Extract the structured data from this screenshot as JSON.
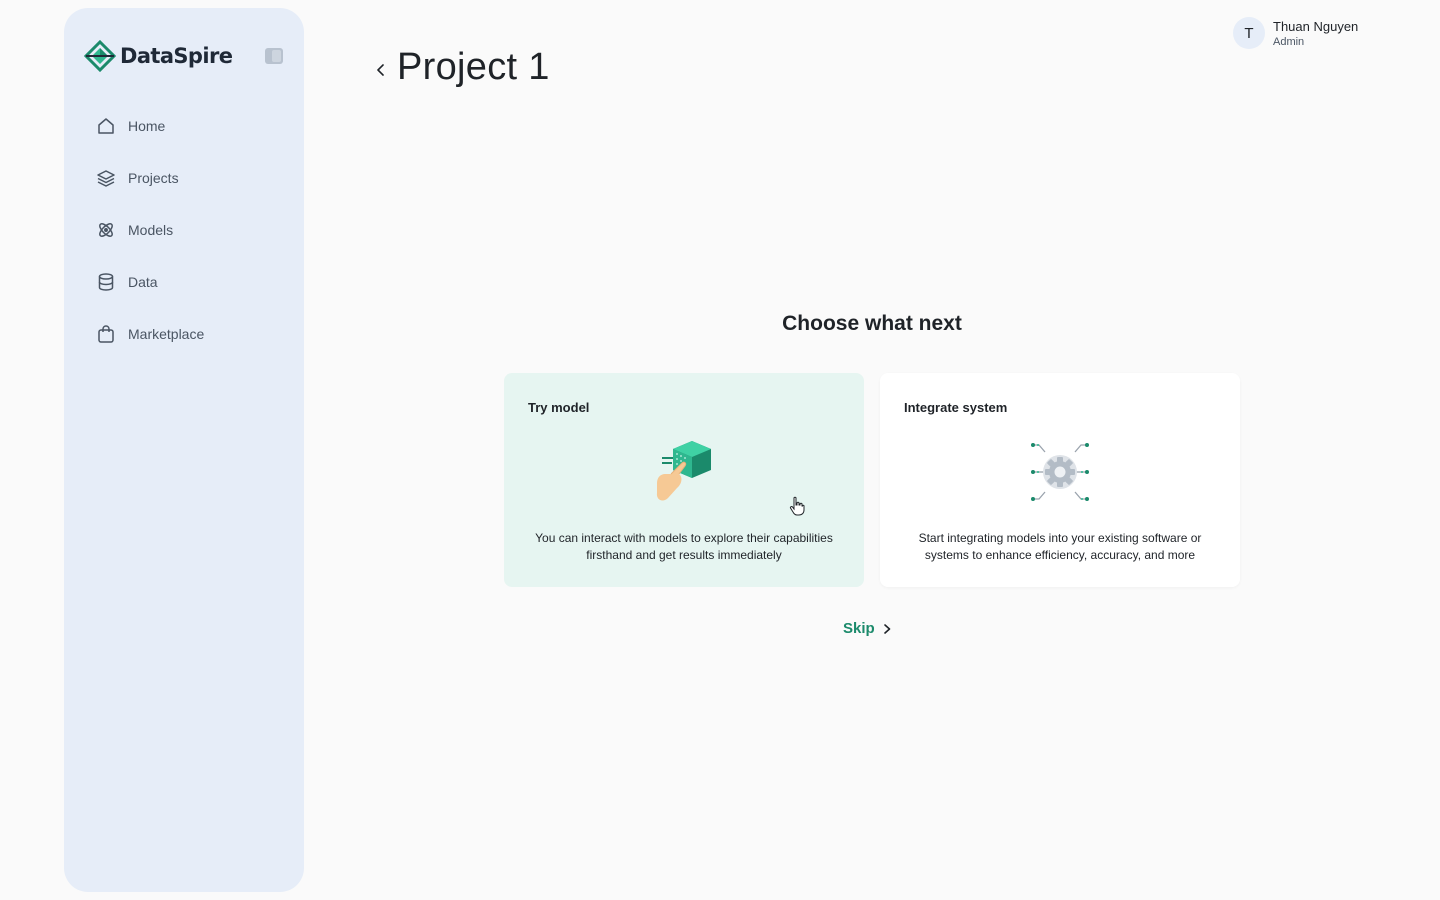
{
  "brand": {
    "name": "DataSpire",
    "accent": "#1b8a6b"
  },
  "sidebar": {
    "items": [
      {
        "label": "Home",
        "icon": "home-icon"
      },
      {
        "label": "Projects",
        "icon": "layers-icon"
      },
      {
        "label": "Models",
        "icon": "atom-icon"
      },
      {
        "label": "Data",
        "icon": "database-icon"
      },
      {
        "label": "Marketplace",
        "icon": "shopping-bag-icon"
      }
    ]
  },
  "header": {
    "title": "Project 1"
  },
  "user": {
    "initial": "T",
    "name": "Thuan Nguyen",
    "role": "Admin"
  },
  "main": {
    "heading": "Choose what next",
    "cards": [
      {
        "title": "Try model",
        "description": "You can interact with models to explore their capabilities firsthand and get results immediately",
        "icon": "hand-cube-icon"
      },
      {
        "title": "Integrate system",
        "description": "Start integrating models into your existing software or systems to enhance efficiency, accuracy, and more",
        "icon": "gear-network-icon"
      }
    ],
    "skip_label": "Skip"
  }
}
